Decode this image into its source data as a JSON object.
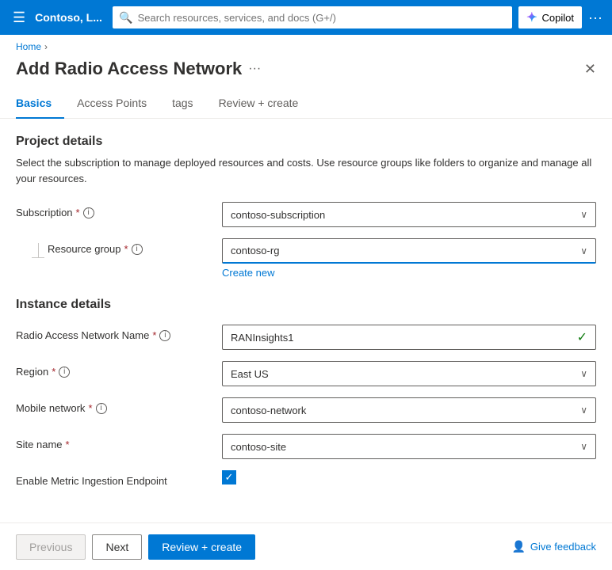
{
  "topbar": {
    "menu_icon": "☰",
    "title": "Contoso, L...",
    "search_placeholder": "Search resources, services, and docs (G+/)",
    "copilot_label": "Copilot",
    "more_icon": "···"
  },
  "breadcrumb": {
    "home": "Home",
    "separator": "›"
  },
  "page": {
    "title": "Add Radio Access Network",
    "more_icon": "···",
    "close_icon": "✕"
  },
  "tabs": [
    {
      "label": "Basics",
      "active": true
    },
    {
      "label": "Access Points",
      "active": false
    },
    {
      "label": "tags",
      "active": false
    },
    {
      "label": "Review + create",
      "active": false
    }
  ],
  "project_details": {
    "title": "Project details",
    "description": "Select the subscription to manage deployed resources and costs. Use resource groups like folders to organize and manage all your resources.",
    "subscription_label": "Subscription",
    "subscription_value": "contoso-subscription",
    "resource_group_label": "Resource group",
    "resource_group_value": "contoso-rg",
    "create_new_label": "Create new"
  },
  "instance_details": {
    "title": "Instance details",
    "ran_name_label": "Radio Access Network Name",
    "ran_name_value": "RANInsights1",
    "region_label": "Region",
    "region_value": "East US",
    "mobile_network_label": "Mobile network",
    "mobile_network_value": "contoso-network",
    "site_name_label": "Site name",
    "site_name_value": "contoso-site",
    "endpoint_label": "Enable Metric Ingestion Endpoint",
    "endpoint_checked": true
  },
  "footer": {
    "previous_label": "Previous",
    "next_label": "Next",
    "review_create_label": "Review + create",
    "feedback_label": "Give feedback",
    "feedback_icon": "👤"
  }
}
